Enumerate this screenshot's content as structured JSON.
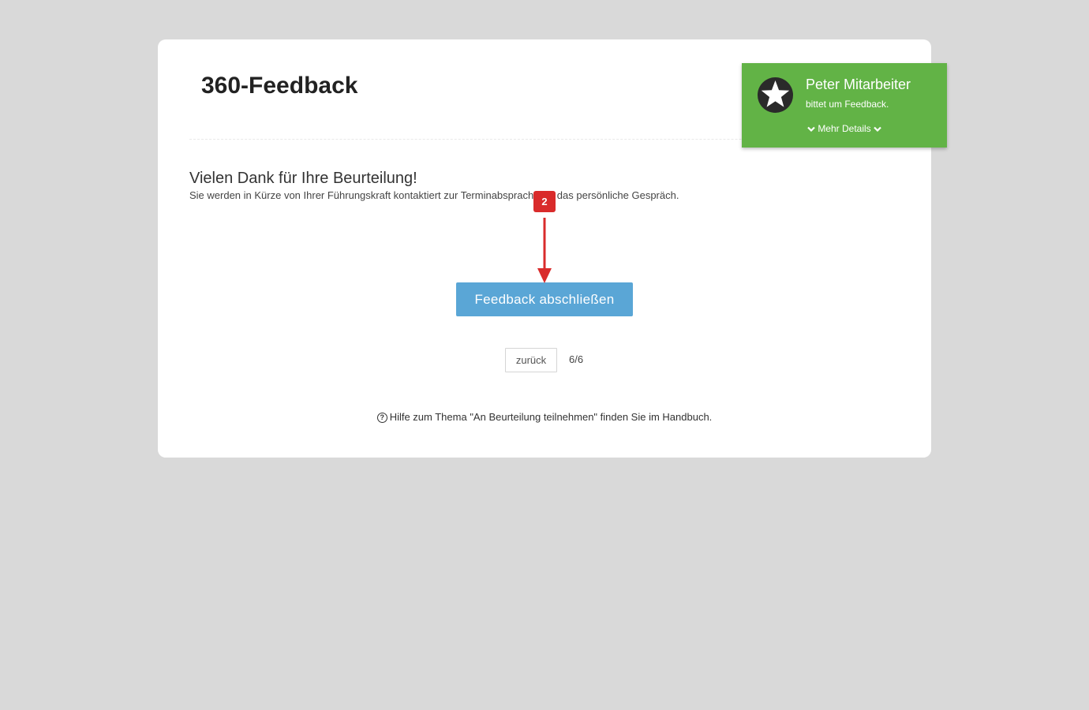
{
  "page": {
    "title": "360-Feedback"
  },
  "content": {
    "heading": "Vielen Dank für Ihre Beurteilung!",
    "text": "Sie werden in Kürze von Ihrer Führungskraft kontaktiert zur Terminabsprache für das persönliche Gespräch."
  },
  "actions": {
    "submit_label": "Feedback abschließen",
    "back_label": "zurück",
    "page_counter": "6/6"
  },
  "help": {
    "icon": "question-circle-icon",
    "text": "Hilfe zum Thema \"An Beurteilung teilnehmen\" finden Sie im Handbuch."
  },
  "notification": {
    "icon": "star-icon",
    "name": "Peter Mitarbeiter",
    "message": "bittet um Feedback.",
    "details_label": "Mehr Details"
  },
  "annotation": {
    "step": "2"
  },
  "colors": {
    "background": "#d9d9d9",
    "card": "#ffffff",
    "primary_button": "#5aa6d6",
    "notification": "#62b346",
    "annotation": "#d92b2b"
  }
}
